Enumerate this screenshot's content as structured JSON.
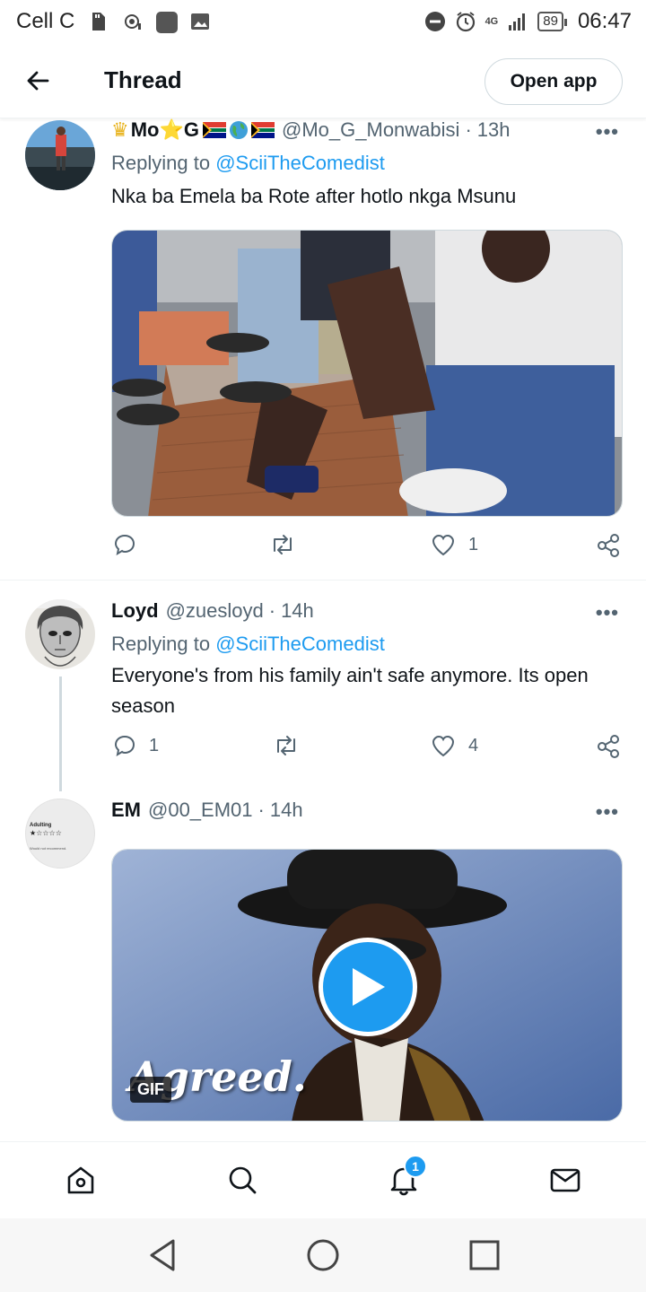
{
  "status_bar": {
    "carrier": "Cell C",
    "network": "4G",
    "battery": "89",
    "time": "06:47"
  },
  "header": {
    "title": "Thread",
    "open_app_label": "Open app"
  },
  "tweets": [
    {
      "display_name": "Mo⭐G",
      "handle": "@Mo_G_Monwabisi",
      "separator": "·",
      "time": "13h",
      "replying_to_prefix": "Replying to",
      "replying_to_handle": "@SciiTheComedist",
      "text": "Nka ba Emela ba Rote after hotlo nkga Msunu",
      "reply_count": "",
      "retweet_count": "",
      "like_count": "1"
    },
    {
      "display_name": "Loyd",
      "handle": "@zuesloyd",
      "separator": "·",
      "time": "14h",
      "replying_to_prefix": "Replying to",
      "replying_to_handle": "@SciiTheComedist",
      "text": "Everyone's from his family ain't safe anymore. Its open season",
      "reply_count": "1",
      "retweet_count": "",
      "like_count": "4"
    },
    {
      "display_name": "EM",
      "handle": "@00_EM01",
      "separator": "·",
      "time": "14h",
      "gif_label": "GIF",
      "gif_caption": "Agreed.",
      "avatar_text_top": "Adulting",
      "avatar_stars": "★☆☆☆☆",
      "avatar_text_bottom": "Would not recommend."
    }
  ],
  "more_label": "•••",
  "bottom_nav": {
    "notification_badge": "1"
  },
  "colors": {
    "accent": "#1d9bf0",
    "text_primary": "#0f1419",
    "text_secondary": "#536471",
    "border": "#cfd9de"
  }
}
